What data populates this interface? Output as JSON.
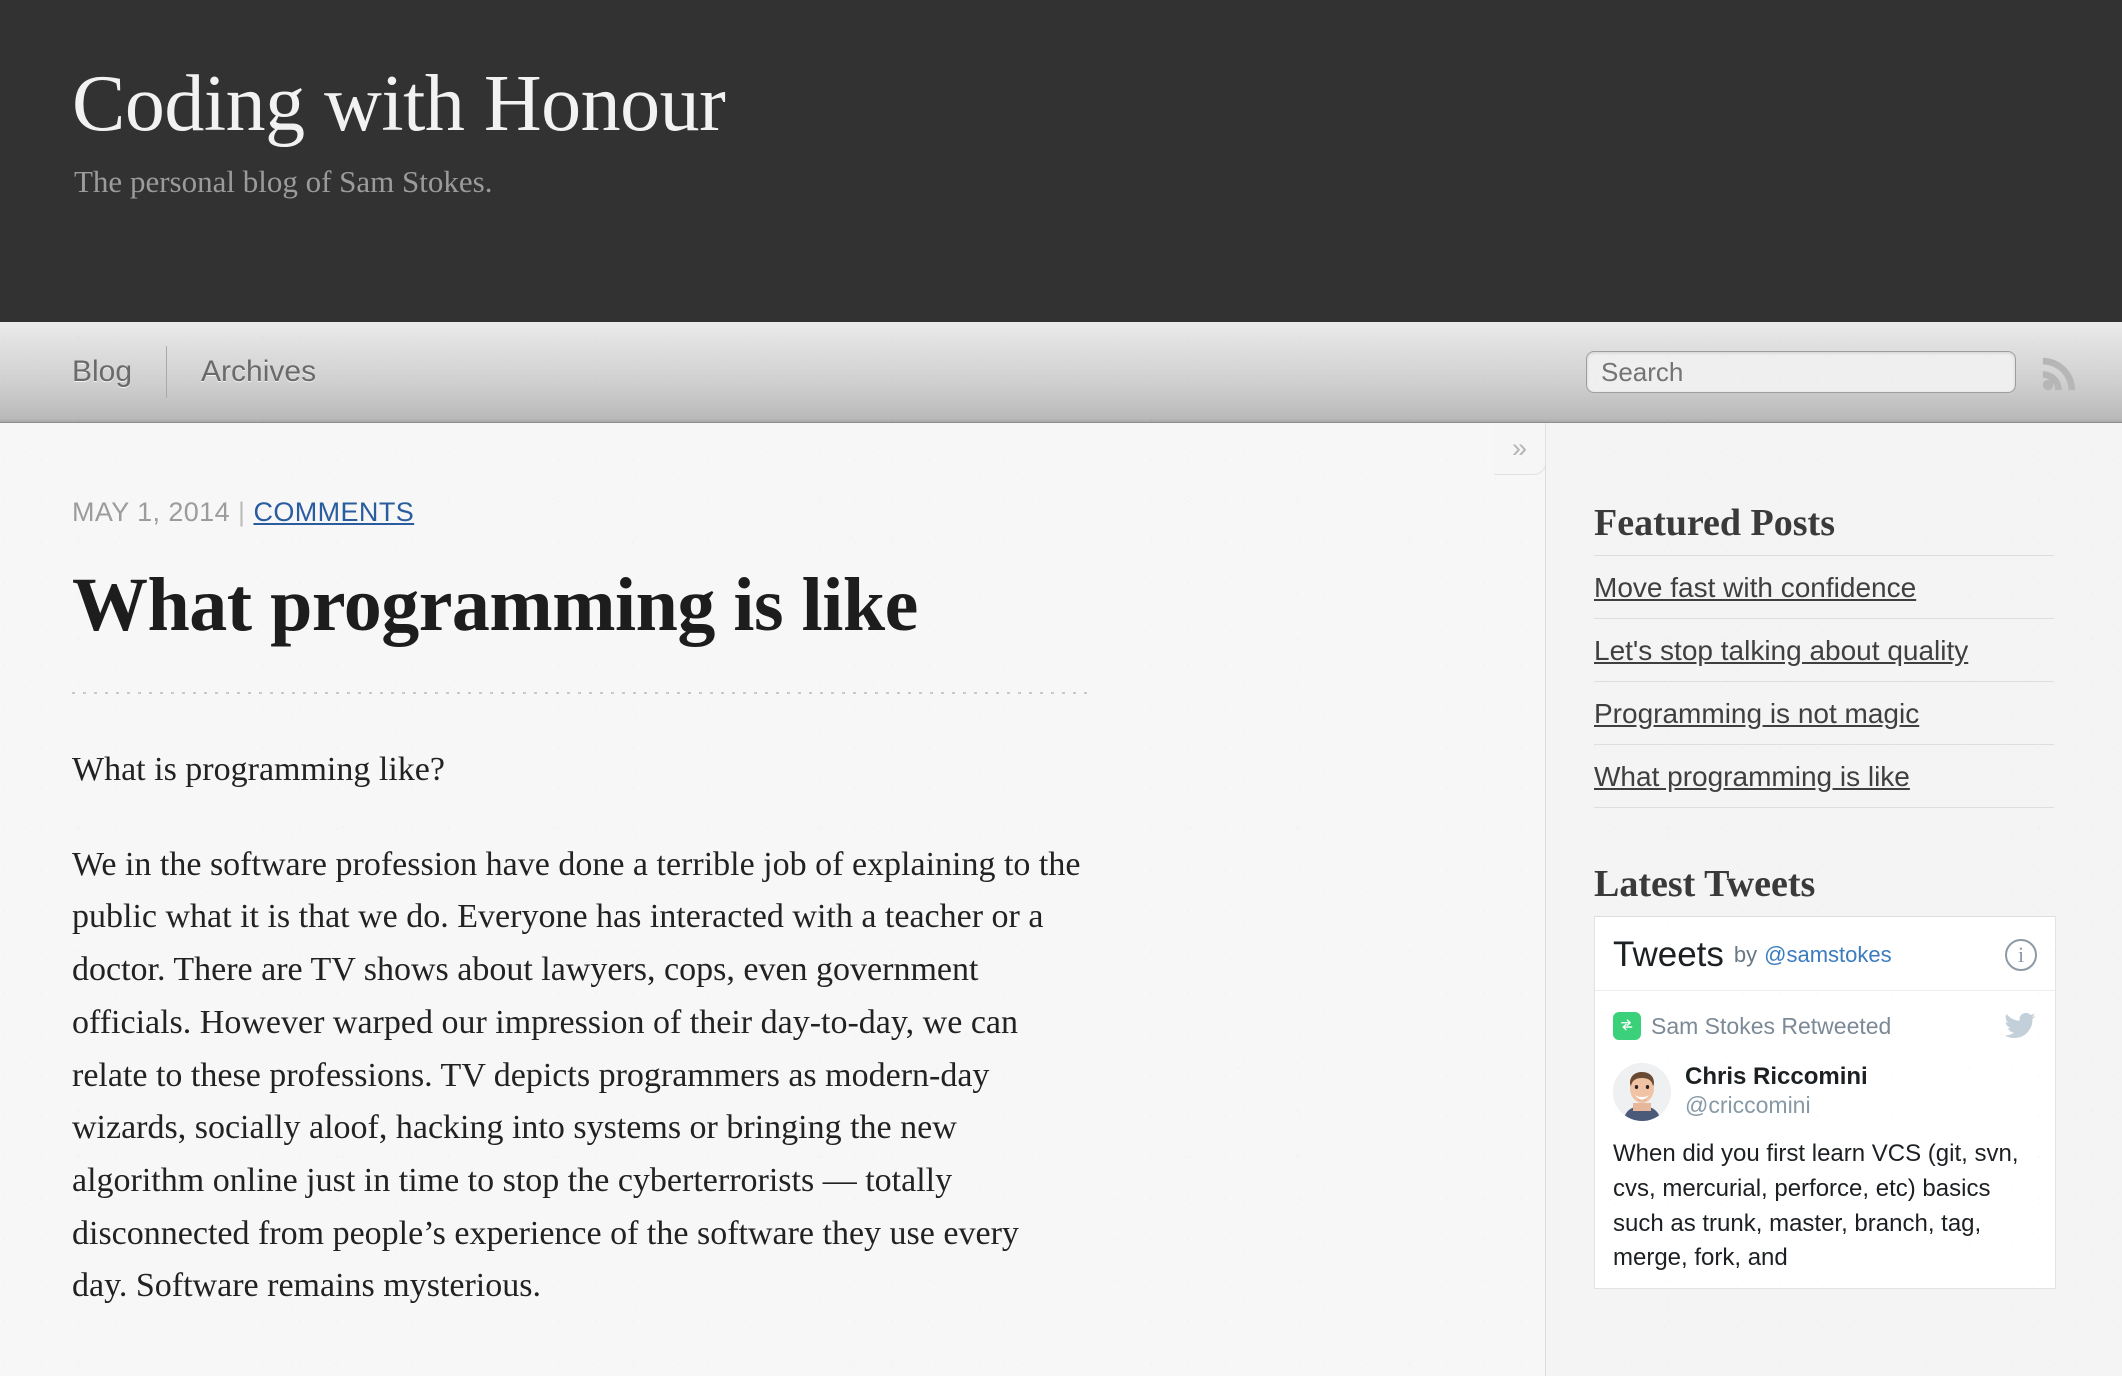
{
  "site": {
    "title": "Coding with Honour",
    "subtitle": "The personal blog of Sam Stokes."
  },
  "nav": {
    "links": [
      {
        "label": "Blog"
      },
      {
        "label": "Archives"
      }
    ],
    "search_placeholder": "Search",
    "search_value": "",
    "rss_icon": "rss-icon"
  },
  "post": {
    "date": "MAY 1, 2014",
    "meta_separator": "|",
    "comments_label": "COMMENTS",
    "title": "What programming is like",
    "paragraphs": [
      "What is programming like?",
      "We in the software profession have done a terrible job of explaining to the public what it is that we do. Everyone has interacted with a teacher or a doctor. There are TV shows about lawyers, cops, even government officials. However warped our impression of their day-to-day, we can relate to these professions. TV depicts programmers as modern-day wizards, socially aloof, hacking into systems or bringing the new algorithm online just in time to stop the cyberterrorists — totally disconnected from people’s experience of the software they use every day. Software remains mysterious."
    ]
  },
  "sidebar": {
    "toggle_label": "»",
    "featured": {
      "heading": "Featured Posts",
      "items": [
        {
          "label": "Move fast with confidence"
        },
        {
          "label": "Let's stop talking about quality"
        },
        {
          "label": "Programming is not magic"
        },
        {
          "label": "What programming is like"
        }
      ]
    },
    "tweets": {
      "heading": "Latest Tweets",
      "widget_title": "Tweets",
      "widget_by": "by",
      "widget_handle": "@samstokes",
      "info_glyph": "i",
      "retweet_text": "Sam Stokes Retweeted",
      "author_name": "Chris Riccomini",
      "author_handle": "@criccomini",
      "tweet_body": "When did you first learn VCS (git, svn, cvs, mercurial, perforce, etc) basics such as trunk, master, branch, tag, merge, fork, and"
    }
  },
  "colors": {
    "masthead_bg": "#333232",
    "page_bg": "#f7f7f7",
    "link_blue": "#2a5d9e",
    "twitter_blue": "#3b7bbf",
    "retweet_green": "#3bd07a"
  }
}
